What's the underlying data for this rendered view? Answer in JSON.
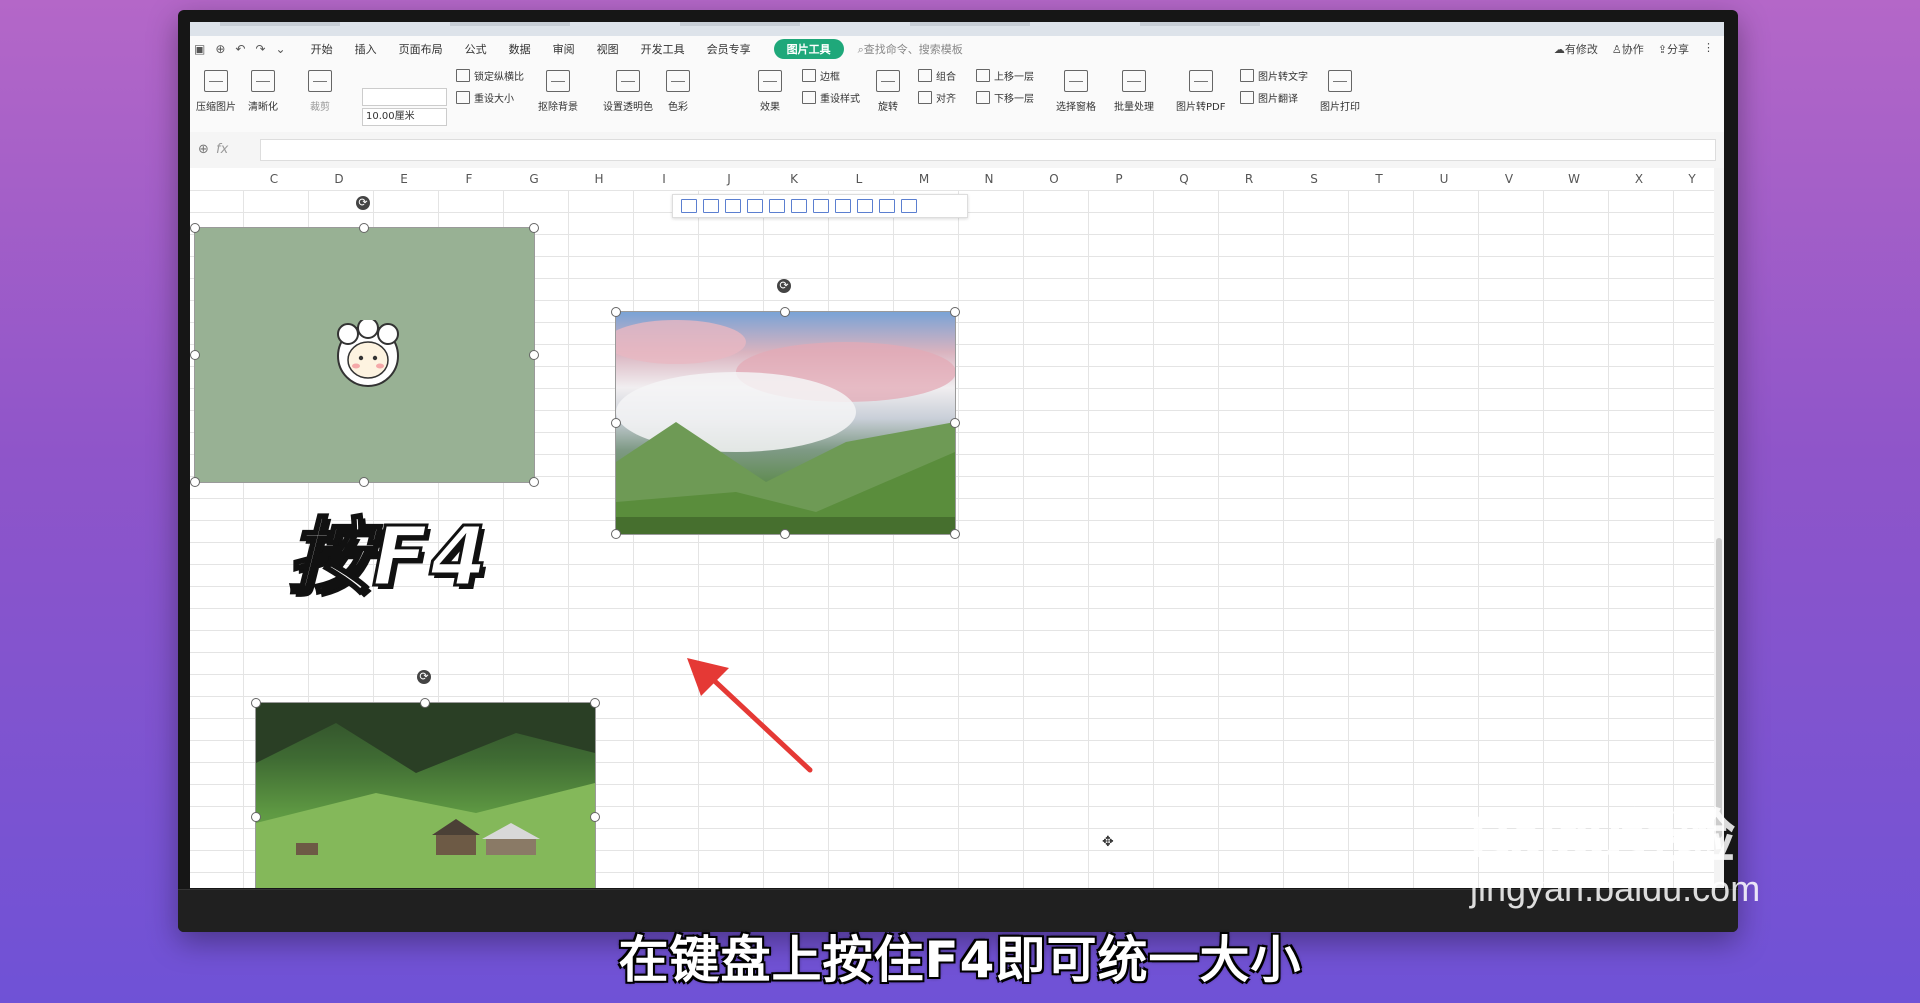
{
  "ribbon": {
    "tabs": [
      "开始",
      "插入",
      "页面布局",
      "公式",
      "数据",
      "审阅",
      "视图",
      "开发工具",
      "会员专享"
    ],
    "active_tab": "图片工具",
    "search_placeholder": "查找命令、搜索模板",
    "right": {
      "modified": "有修改",
      "collaborate": "协作",
      "share": "分享"
    }
  },
  "toolbar": {
    "compress": "压缩图片",
    "clarity": "清晰化",
    "crop": "裁剪",
    "size_value": "10.00厘米",
    "lock_ratio": "锁定纵横比",
    "reset_size": "重设大小",
    "remove_bg": "抠除背景",
    "set_transparent": "设置透明色",
    "color": "色彩",
    "effects": "效果",
    "border": "边框",
    "reset_style": "重设样式",
    "rotate": "旋转",
    "group": "组合",
    "align": "对齐",
    "bring_forward": "上移一层",
    "send_backward": "下移一层",
    "selection_pane": "选择窗格",
    "batch": "批量处理",
    "to_pdf": "图片转PDF",
    "to_text": "图片转文字",
    "translate": "图片翻译",
    "print": "图片打印"
  },
  "formula_bar": {
    "fx": "fx"
  },
  "columns": [
    "C",
    "D",
    "E",
    "F",
    "G",
    "H",
    "I",
    "J",
    "K",
    "L",
    "M",
    "N",
    "O",
    "P",
    "Q",
    "R",
    "S",
    "T",
    "U",
    "V",
    "W",
    "X",
    "Y"
  ],
  "overlay_text": "按F4",
  "caption": "在键盘上按住F4即可统一大小",
  "watermark": {
    "logo": "Baidu经验",
    "url": "jingyan.baidu.com"
  },
  "colors": {
    "accent": "#1fa87a",
    "arrow": "#e53935",
    "sheep_bg": "#98b194"
  }
}
